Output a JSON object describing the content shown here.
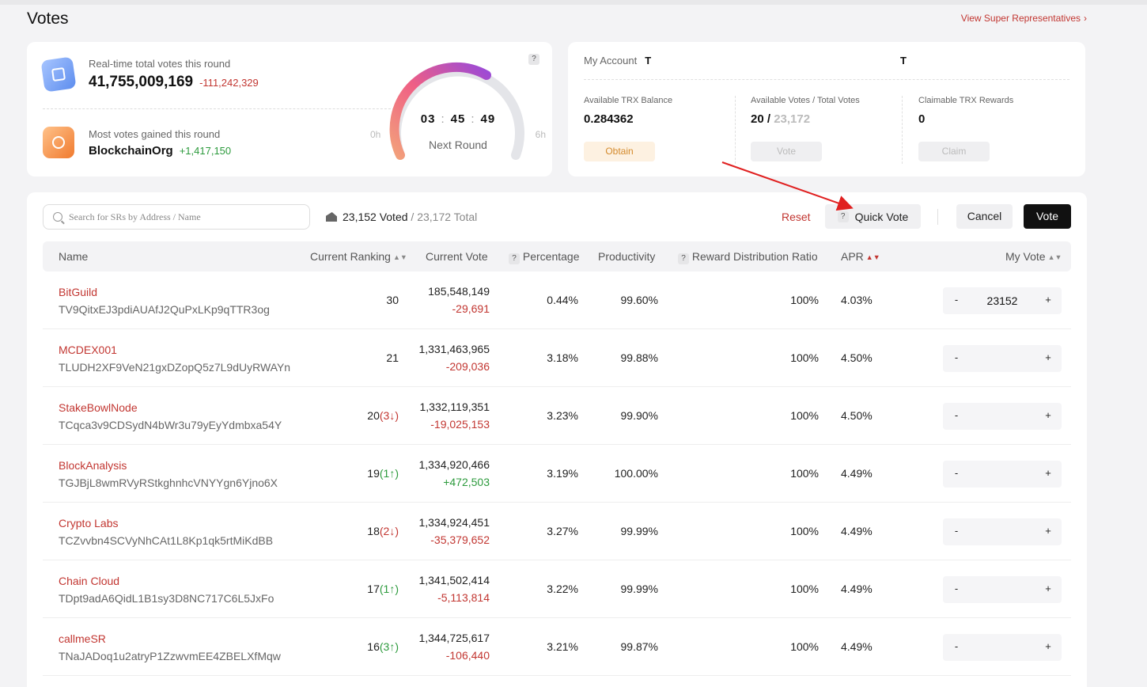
{
  "page": {
    "title": "Votes",
    "view_sr_link": "View Super Representatives",
    "chevron": "›"
  },
  "stats": {
    "realtime_label": "Real-time total votes this round",
    "realtime_value": "41,755,009,169",
    "realtime_delta": "-111,242,329",
    "most_label": "Most votes gained this round",
    "most_name": "BlockchainOrg",
    "most_delta": "+1,417,150",
    "gauge_start": "0h",
    "gauge_end": "6h",
    "timer_h": "03",
    "timer_m": "45",
    "timer_s": "49",
    "timer_sep": ":",
    "next_round": "Next Round",
    "help": "?"
  },
  "account": {
    "label": "My Account",
    "address_1": "T",
    "address_2": "T",
    "balance_label": "Available TRX Balance",
    "balance_value": "0.284362",
    "obtain_button": "Obtain",
    "votes_label": "Available Votes / Total Votes",
    "votes_available": "20",
    "votes_sep": "/",
    "votes_total": "23,172",
    "vote_button": "Vote",
    "rewards_label": "Claimable TRX Rewards",
    "rewards_value": "0",
    "claim_button": "Claim"
  },
  "toolbar": {
    "search_placeholder": "Search for SRs by Address / Name",
    "voted_count": "23,152 Voted",
    "voted_total": "/ 23,172 Total",
    "reset": "Reset",
    "quick_vote": "Quick Vote",
    "cancel": "Cancel",
    "vote": "Vote",
    "help": "?"
  },
  "table": {
    "headers": {
      "name": "Name",
      "ranking": "Current Ranking",
      "current_vote": "Current Vote",
      "percentage": "Percentage",
      "productivity": "Productivity",
      "reward_ratio": "Reward Distribution Ratio",
      "apr": "APR",
      "my_vote": "My Vote",
      "sort_icon": "▲▼"
    },
    "rows": [
      {
        "name": "BitGuild",
        "address": "TV9QitxEJ3pdiAUAfJ2QuPxLKp9qTTR3og",
        "rank": "30",
        "rank_change": "",
        "rank_dir": "",
        "current_vote": "185,548,149",
        "vote_delta": "-29,691",
        "delta_sign": "neg",
        "percentage": "0.44%",
        "productivity": "99.60%",
        "reward_ratio": "100%",
        "apr": "4.03%",
        "my_vote": "23152"
      },
      {
        "name": "MCDEX001",
        "address": "TLUDH2XF9VeN21gxDZopQ5z7L9dUyRWAYn",
        "rank": "21",
        "rank_change": "",
        "rank_dir": "",
        "current_vote": "1,331,463,965",
        "vote_delta": "-209,036",
        "delta_sign": "neg",
        "percentage": "3.18%",
        "productivity": "99.88%",
        "reward_ratio": "100%",
        "apr": "4.50%",
        "my_vote": ""
      },
      {
        "name": "StakeBowlNode",
        "address": "TCqca3v9CDSydN4bWr3u79yEyYdmbxa54Y",
        "rank": "20",
        "rank_change": "3",
        "rank_dir": "down",
        "current_vote": "1,332,119,351",
        "vote_delta": "-19,025,153",
        "delta_sign": "neg",
        "percentage": "3.23%",
        "productivity": "99.90%",
        "reward_ratio": "100%",
        "apr": "4.50%",
        "my_vote": ""
      },
      {
        "name": "BlockAnalysis",
        "address": "TGJBjL8wmRVyRStkghnhcVNYYgn6Yjno6X",
        "rank": "19",
        "rank_change": "1",
        "rank_dir": "up",
        "current_vote": "1,334,920,466",
        "vote_delta": "+472,503",
        "delta_sign": "pos",
        "percentage": "3.19%",
        "productivity": "100.00%",
        "reward_ratio": "100%",
        "apr": "4.49%",
        "my_vote": ""
      },
      {
        "name": "Crypto Labs",
        "address": "TCZvvbn4SCVyNhCAt1L8Kp1qk5rtMiKdBB",
        "rank": "18",
        "rank_change": "2",
        "rank_dir": "down",
        "current_vote": "1,334,924,451",
        "vote_delta": "-35,379,652",
        "delta_sign": "neg",
        "percentage": "3.27%",
        "productivity": "99.99%",
        "reward_ratio": "100%",
        "apr": "4.49%",
        "my_vote": ""
      },
      {
        "name": "Chain Cloud",
        "address": "TDpt9adA6QidL1B1sy3D8NC717C6L5JxFo",
        "rank": "17",
        "rank_change": "1",
        "rank_dir": "up",
        "current_vote": "1,341,502,414",
        "vote_delta": "-5,113,814",
        "delta_sign": "neg",
        "percentage": "3.22%",
        "productivity": "99.99%",
        "reward_ratio": "100%",
        "apr": "4.49%",
        "my_vote": ""
      },
      {
        "name": "callmeSR",
        "address": "TNaJADoq1u2atryP1ZzwvmEE4ZBELXfMqw",
        "rank": "16",
        "rank_change": "3",
        "rank_dir": "up",
        "current_vote": "1,344,725,617",
        "vote_delta": "-106,440",
        "delta_sign": "neg",
        "percentage": "3.21%",
        "productivity": "99.87%",
        "reward_ratio": "100%",
        "apr": "4.49%",
        "my_vote": ""
      }
    ],
    "stepper_minus": "-",
    "stepper_plus": "+"
  },
  "colors": {
    "accent_red": "#c23631",
    "positive_green": "#2c9a3c",
    "annotation_arrow": "#e02020"
  }
}
